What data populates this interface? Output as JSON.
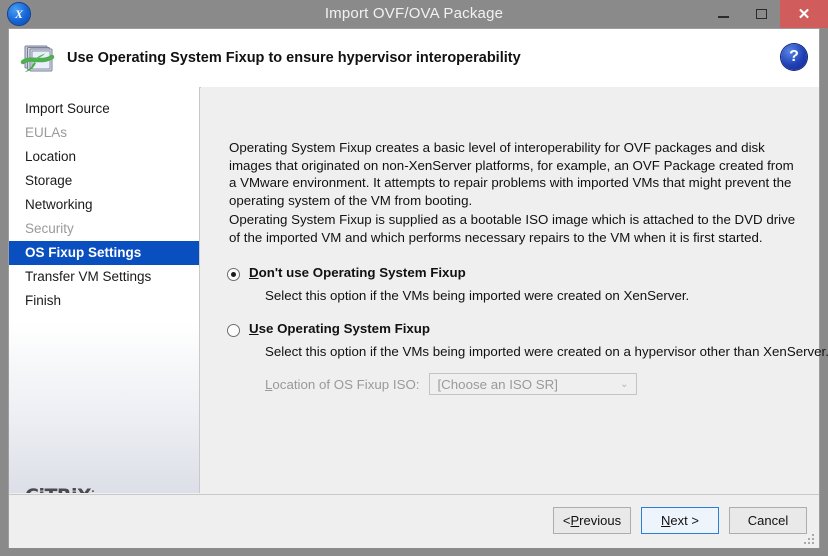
{
  "window": {
    "title": "Import OVF/OVA Package",
    "app_icon": "xencenter-x-icon",
    "controls": {
      "minimize": "minimize-icon",
      "maximize": "maximize-icon",
      "close": "close-icon",
      "close_glyph": "✕"
    }
  },
  "header": {
    "icon": "ovf-package-icon",
    "title": "Use Operating System Fixup to ensure hypervisor interoperability",
    "help_icon": "help-question-icon",
    "help_glyph": "?"
  },
  "sidebar": {
    "items": [
      {
        "label": "Import Source",
        "state": "normal"
      },
      {
        "label": "EULAs",
        "state": "disabled"
      },
      {
        "label": "Location",
        "state": "normal"
      },
      {
        "label": "Storage",
        "state": "normal"
      },
      {
        "label": "Networking",
        "state": "normal"
      },
      {
        "label": "Security",
        "state": "disabled"
      },
      {
        "label": "OS Fixup Settings",
        "state": "selected"
      },
      {
        "label": "Transfer VM Settings",
        "state": "normal"
      },
      {
        "label": "Finish",
        "state": "normal"
      }
    ],
    "brand": "CiTRiX",
    "brand_sup": "·"
  },
  "content": {
    "paragraph1": "Operating System Fixup creates a basic level of interoperability for OVF packages and disk images that originated on non-XenServer platforms, for example, an OVF Package created from a VMware environment. It attempts to repair problems with imported VMs that might prevent the operating system of the VM from booting.",
    "paragraph2": "Operating System Fixup is supplied as a bootable ISO image which is attached to the DVD drive of the imported VM and which performs necessary repairs to the VM when it is first started.",
    "options": [
      {
        "mnemonic": "D",
        "label_rest": "on't use Operating System Fixup",
        "description": "Select this option if the VMs being imported were created on XenServer.",
        "selected": true
      },
      {
        "mnemonic": "U",
        "label_rest": "se Operating System Fixup",
        "description": "Select this option if the VMs being imported were created on a hypervisor other than XenServer.",
        "selected": false
      }
    ],
    "iso": {
      "mnemonic": "L",
      "label_rest": "ocation of OS Fixup ISO:",
      "value": "[Choose an ISO SR]",
      "chevron": "⌄",
      "disabled": true
    }
  },
  "footer": {
    "buttons": [
      {
        "prefix": "< ",
        "mnemonic": "P",
        "rest": "revious",
        "default": false
      },
      {
        "prefix": "",
        "mnemonic": "N",
        "rest": "ext >",
        "default": true
      },
      {
        "prefix": "",
        "mnemonic": "",
        "rest": "Cancel",
        "default": false
      }
    ]
  },
  "colors": {
    "titlebar": "#8a8a8a",
    "close_button": "#d05c5c",
    "selection_blue": "#0a4fbf",
    "content_bg": "#efefef",
    "default_button_border": "#2a7fd4"
  }
}
